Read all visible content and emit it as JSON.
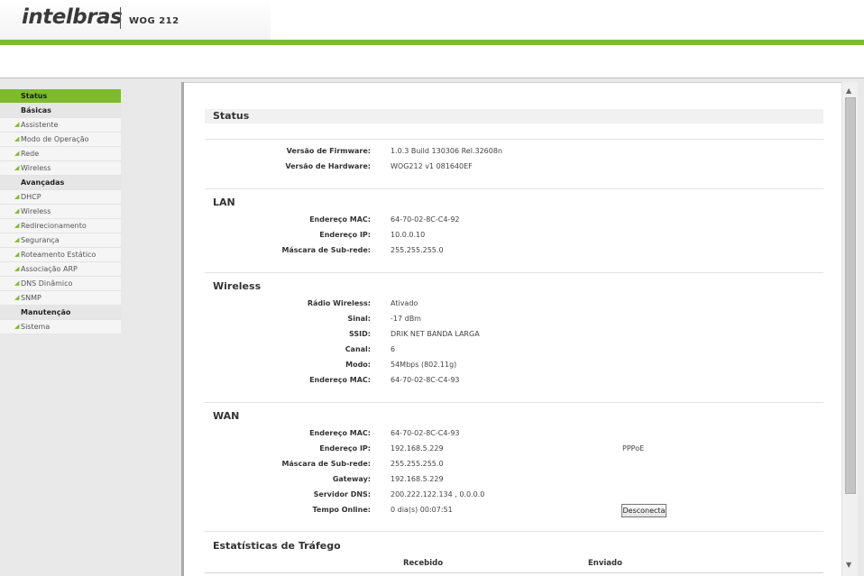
{
  "header": {
    "brand": "intelbras",
    "model": "WOG 212"
  },
  "sidebar": {
    "items": [
      {
        "label": "Status",
        "kind": "active"
      },
      {
        "label": "Básicas",
        "kind": "section"
      },
      {
        "label": "Assistente",
        "kind": "item"
      },
      {
        "label": "Modo de Operação",
        "kind": "item"
      },
      {
        "label": "Rede",
        "kind": "item"
      },
      {
        "label": "Wireless",
        "kind": "item"
      },
      {
        "label": "Avançadas",
        "kind": "section"
      },
      {
        "label": "DHCP",
        "kind": "item"
      },
      {
        "label": "Wireless",
        "kind": "item"
      },
      {
        "label": "Redirecionamento",
        "kind": "item"
      },
      {
        "label": "Segurança",
        "kind": "item"
      },
      {
        "label": "Roteamento Estático",
        "kind": "item"
      },
      {
        "label": "Associação ARP",
        "kind": "item"
      },
      {
        "label": "DNS Dinâmico",
        "kind": "item"
      },
      {
        "label": "SNMP",
        "kind": "item"
      },
      {
        "label": "Manutenção",
        "kind": "section"
      },
      {
        "label": "Sistema",
        "kind": "item"
      }
    ]
  },
  "status": {
    "title": "Status",
    "firmware_label": "Versão de Firmware:",
    "firmware_value": "1.0.3 Build 130306 Rel.32608n",
    "hardware_label": "Versão de Hardware:",
    "hardware_value": "WOG212 v1 081640EF"
  },
  "lan": {
    "title": "LAN",
    "mac_label": "Endereço MAC:",
    "mac_value": "64-70-02-8C-C4-92",
    "ip_label": "Endereço IP:",
    "ip_value": "10.0.0.10",
    "mask_label": "Máscara de Sub-rede:",
    "mask_value": "255.255.255.0"
  },
  "wireless": {
    "title": "Wireless",
    "radio_label": "Rádio Wireless:",
    "radio_value": "Ativado",
    "signal_label": "Sinal:",
    "signal_value": "-17 dBm",
    "ssid_label": "SSID:",
    "ssid_value": "DRIK NET BANDA LARGA",
    "channel_label": "Canal:",
    "channel_value": "6",
    "mode_label": "Modo:",
    "mode_value": "54Mbps (802.11g)",
    "mac_label": "Endereço MAC:",
    "mac_value": "64-70-02-8C-C4-93"
  },
  "wan": {
    "title": "WAN",
    "mac_label": "Endereço MAC:",
    "mac_value": "64-70-02-8C-C4-93",
    "ip_label": "Endereço IP:",
    "ip_value": "192.168.5.229",
    "conn_type": "PPPoE",
    "mask_label": "Máscara de Sub-rede:",
    "mask_value": "255.255.255.0",
    "gateway_label": "Gateway:",
    "gateway_value": "192.168.5.229",
    "dns_label": "Servidor DNS:",
    "dns_value": "200.222.122.134 , 0.0.0.0",
    "online_label": "Tempo Online:",
    "online_value": "0 dia(s) 00:07:51",
    "disconnect_label": "Desconecta"
  },
  "traffic": {
    "title": "Estatísticas de Tráfego",
    "received_label": "Recebido",
    "sent_label": "Enviado"
  },
  "scrollbar": {
    "up_icon": "▲",
    "down_icon": "▼"
  },
  "colors": {
    "accent": "#7dbb2c"
  }
}
